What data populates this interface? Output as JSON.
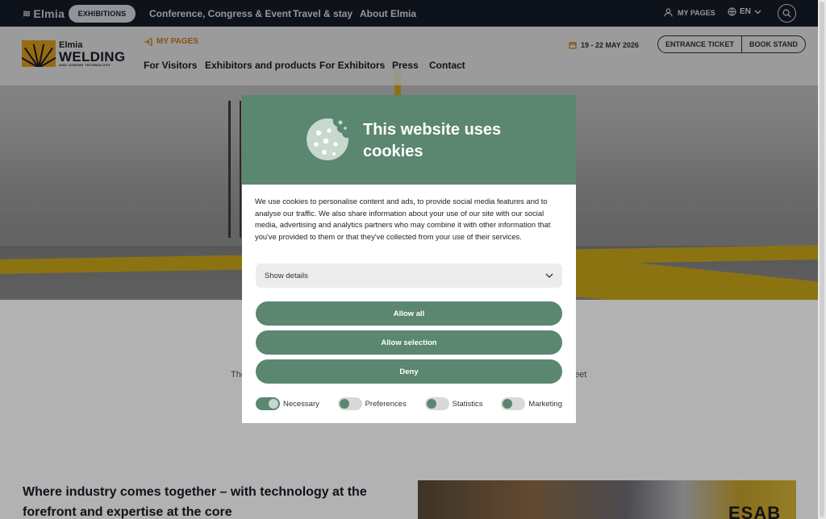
{
  "topbar": {
    "brand": "Elmia",
    "exhibitions_label": "EXHIBITIONS",
    "nav": [
      "Conference, Congress & Event",
      "Travel & stay",
      "About Elmia"
    ],
    "my_pages": "MY PAGES",
    "language": "EN"
  },
  "header": {
    "logo_line1": "Elmia",
    "logo_line2": "WELDING",
    "logo_line3": "AND JOINING TECHNOLOGY",
    "my_pages": "MY PAGES",
    "nav": [
      "For Visitors",
      "Exhibitors and products",
      "For Exhibitors",
      "Press",
      "Contact"
    ],
    "date": "19 - 22 MAY 2026",
    "entrance_ticket": "ENTRANCE TICKET",
    "book_stand": "BOOK STAND"
  },
  "content": {
    "behind_left": "The",
    "behind_right": "eet",
    "headline": "Where industry comes together – with technology at the forefront and expertise at the core",
    "photo_brand": "ESAB"
  },
  "cookie": {
    "title": "This website uses cookies",
    "text": "We use cookies to personalise content and ads, to provide social media features and to analyse our traffic. We also share information about your use of our site with our social media, advertising and analytics partners who may combine it with other information that you've provided to them or that they've collected from your use of their services.",
    "show_details": "Show details",
    "allow_all": "Allow all",
    "allow_selection": "Allow selection",
    "deny": "Deny",
    "toggles": {
      "necessary": "Necessary",
      "preferences": "Preferences",
      "statistics": "Statistics",
      "marketing": "Marketing"
    }
  },
  "colors": {
    "topbar": "#151b26",
    "accent_green": "#5b8670",
    "accent_orange": "#c7701b"
  }
}
